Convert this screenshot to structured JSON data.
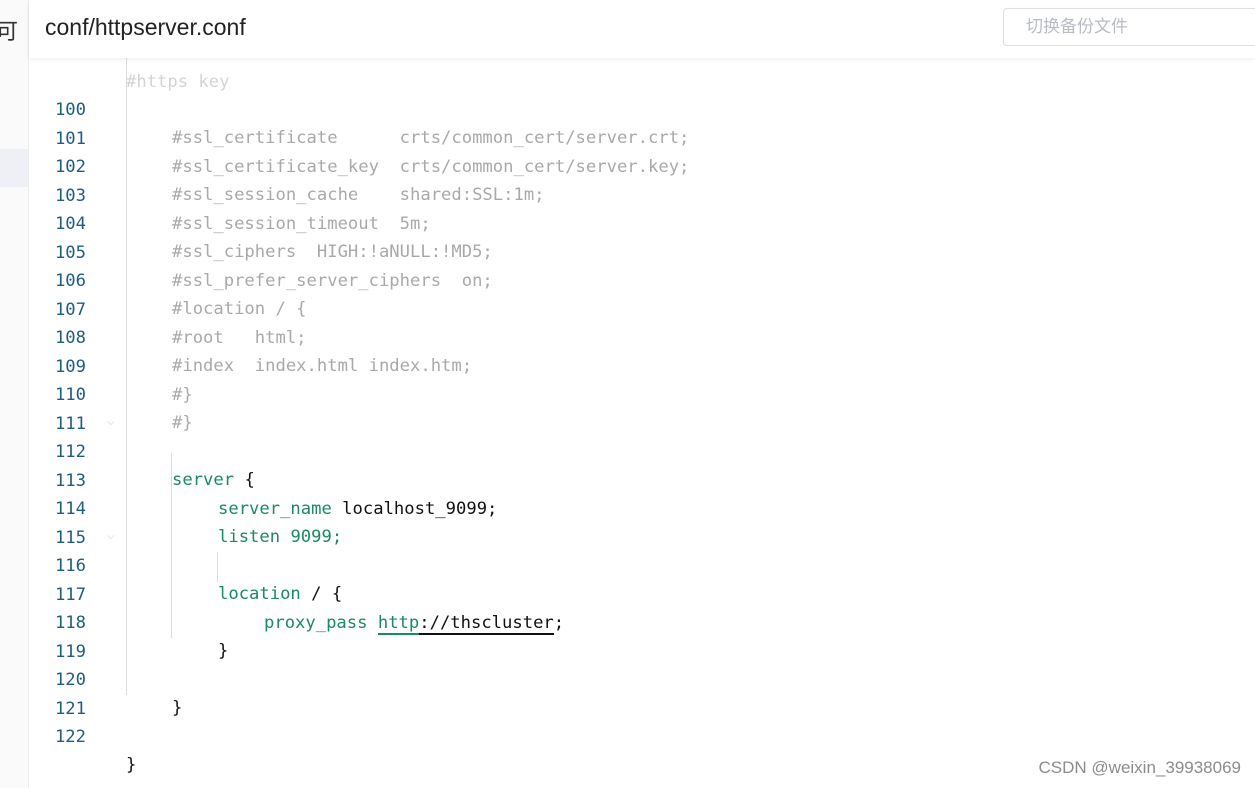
{
  "header": {
    "title": "conf/httpserver.conf",
    "switch_placeholder": "切换备份文件"
  },
  "sidebar": {
    "glyph": "可"
  },
  "editor": {
    "lines": [
      {
        "n": "100",
        "text": "#ssl_certificate      crts/common_cert/server.crt;"
      },
      {
        "n": "101",
        "text": "#ssl_certificate_key  crts/common_cert/server.key;"
      },
      {
        "n": "102",
        "text": "#ssl_session_cache    shared:SSL:1m;"
      },
      {
        "n": "103",
        "text": "#ssl_session_timeout  5m;"
      },
      {
        "n": "104",
        "text": "#ssl_ciphers  HIGH:!aNULL:!MD5;"
      },
      {
        "n": "105",
        "text": "#ssl_prefer_server_ciphers  on;"
      },
      {
        "n": "106",
        "text": "#location / {"
      },
      {
        "n": "107",
        "text": "#root   html;"
      },
      {
        "n": "108",
        "text": "#index  index.html index.htm;"
      },
      {
        "n": "109",
        "text": "#}"
      },
      {
        "n": "110",
        "text": "#}"
      },
      {
        "n": "111",
        "text": ""
      },
      {
        "n": "112",
        "kw": "server",
        "rest": " {"
      },
      {
        "n": "113",
        "kw": "server_name",
        "rest": " localhost_9099;"
      },
      {
        "n": "114",
        "kw": "listen",
        "rest": " 9099;"
      },
      {
        "n": "115",
        "text": ""
      },
      {
        "n": "116",
        "kw": "location",
        "rest": " / {"
      },
      {
        "n": "117",
        "kw": "proxy_pass",
        "sp": " ",
        "url_scheme": "http",
        "url_rest": "://thscluster",
        "end": ";"
      },
      {
        "n": "118",
        "text": "}"
      },
      {
        "n": "119",
        "text": ""
      },
      {
        "n": "120",
        "text": "}"
      },
      {
        "n": "121",
        "text": ""
      },
      {
        "n": "122",
        "text": "}"
      }
    ]
  },
  "watermark": "CSDN @weixin_39938069"
}
